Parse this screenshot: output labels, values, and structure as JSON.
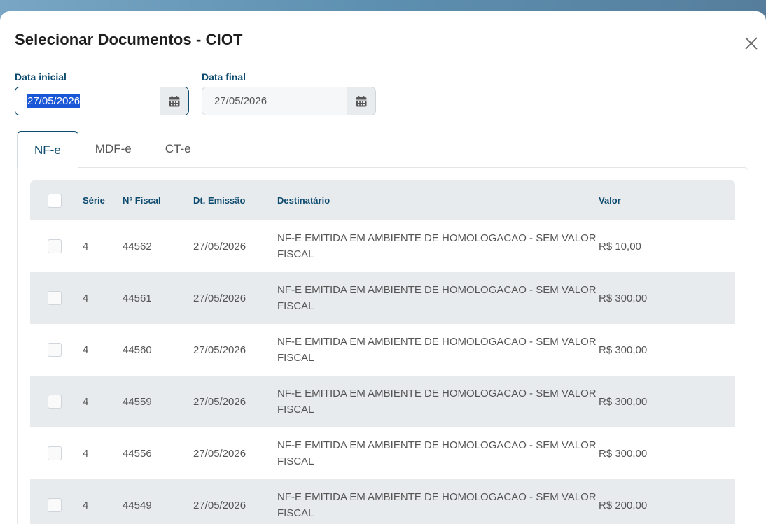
{
  "modal": {
    "title": "Selecionar Documentos - CIOT"
  },
  "filters": {
    "start_label": "Data inicial",
    "start_value": "27/05/2026",
    "end_label": "Data final",
    "end_value": "27/05/2026"
  },
  "tabs": [
    {
      "label": "NF-e",
      "active": true
    },
    {
      "label": "MDF-e",
      "active": false
    },
    {
      "label": "CT-e",
      "active": false
    }
  ],
  "table": {
    "headers": {
      "serie": "Série",
      "numero": "Nº Fiscal",
      "emissao": "Dt. Emissão",
      "destinatario": "Destinatário",
      "valor": "Valor"
    },
    "rows": [
      {
        "serie": "4",
        "numero": "44562",
        "emissao": "27/05/2026",
        "destinatario": "NF-E EMITIDA EM AMBIENTE DE HOMOLOGACAO - SEM VALOR FISCAL",
        "valor": "R$ 10,00"
      },
      {
        "serie": "4",
        "numero": "44561",
        "emissao": "27/05/2026",
        "destinatario": "NF-E EMITIDA EM AMBIENTE DE HOMOLOGACAO - SEM VALOR FISCAL",
        "valor": "R$ 300,00"
      },
      {
        "serie": "4",
        "numero": "44560",
        "emissao": "27/05/2026",
        "destinatario": "NF-E EMITIDA EM AMBIENTE DE HOMOLOGACAO - SEM VALOR FISCAL",
        "valor": "R$ 300,00"
      },
      {
        "serie": "4",
        "numero": "44559",
        "emissao": "27/05/2026",
        "destinatario": "NF-E EMITIDA EM AMBIENTE DE HOMOLOGACAO - SEM VALOR FISCAL",
        "valor": "R$ 300,00"
      },
      {
        "serie": "4",
        "numero": "44556",
        "emissao": "27/05/2026",
        "destinatario": "NF-E EMITIDA EM AMBIENTE DE HOMOLOGACAO - SEM VALOR FISCAL",
        "valor": "R$ 300,00"
      },
      {
        "serie": "4",
        "numero": "44549",
        "emissao": "27/05/2026",
        "destinatario": "NF-E EMITIDA EM AMBIENTE DE HOMOLOGACAO - SEM VALOR FISCAL",
        "valor": "R$ 200,00"
      }
    ]
  },
  "colors": {
    "accent": "#0c4a6e",
    "selection": "#1a57d6",
    "row_alt": "#e8ebee"
  },
  "icons": {
    "close": "close-icon",
    "calendar": "calendar-icon"
  }
}
